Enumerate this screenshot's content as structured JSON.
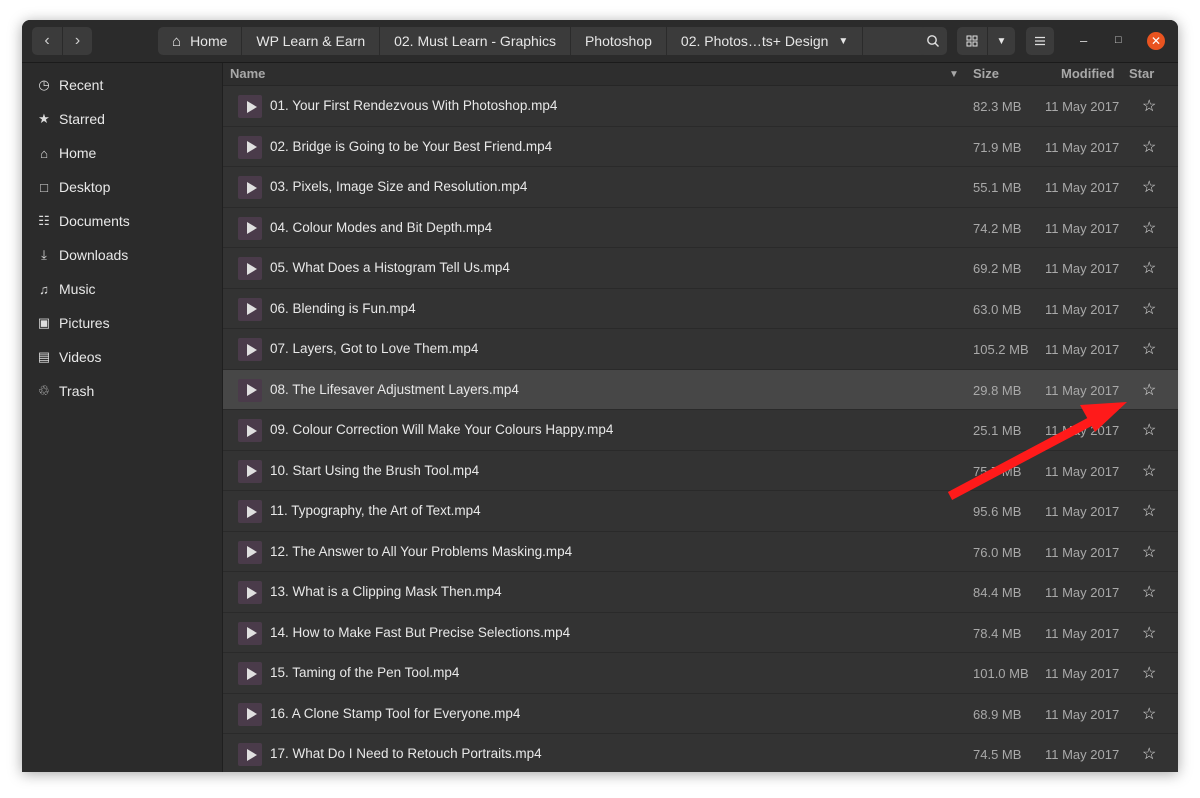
{
  "accent_color": "#e95420",
  "annotation_color": "#ff1a1a",
  "navigation": {
    "back_icon": "chevron-left-icon",
    "forward_icon": "chevron-right-icon"
  },
  "pathbar": {
    "home_icon": "home-icon",
    "crumbs": [
      "Home",
      "WP Learn & Earn",
      "02. Must Learn - Graphics",
      "Photoshop",
      "02. Photos…ts+ Design"
    ]
  },
  "sidebar": {
    "items": [
      {
        "label": "Recent",
        "icon": "clock-icon"
      },
      {
        "label": "Starred",
        "icon": "star-icon"
      },
      {
        "label": "Home",
        "icon": "home-icon"
      },
      {
        "label": "Desktop",
        "icon": "desktop-icon"
      },
      {
        "label": "Documents",
        "icon": "document-icon"
      },
      {
        "label": "Downloads",
        "icon": "download-icon"
      },
      {
        "label": "Music",
        "icon": "music-icon"
      },
      {
        "label": "Pictures",
        "icon": "picture-icon"
      },
      {
        "label": "Videos",
        "icon": "video-icon"
      },
      {
        "label": "Trash",
        "icon": "trash-icon"
      }
    ]
  },
  "columns": {
    "name": "Name",
    "size": "Size",
    "modified": "Modified",
    "star": "Star"
  },
  "files": [
    {
      "name": "01. Your First Rendezvous With Photoshop.mp4",
      "size": "82.3 MB",
      "modified": "11 May 2017"
    },
    {
      "name": "02. Bridge is Going to be Your Best Friend.mp4",
      "size": "71.9 MB",
      "modified": "11 May 2017"
    },
    {
      "name": "03. Pixels, Image Size and Resolution.mp4",
      "size": "55.1 MB",
      "modified": "11 May 2017"
    },
    {
      "name": "04. Colour Modes and Bit Depth.mp4",
      "size": "74.2 MB",
      "modified": "11 May 2017"
    },
    {
      "name": "05. What Does a Histogram Tell Us.mp4",
      "size": "69.2 MB",
      "modified": "11 May 2017"
    },
    {
      "name": "06. Blending is Fun.mp4",
      "size": "63.0 MB",
      "modified": "11 May 2017"
    },
    {
      "name": "07. Layers, Got to Love Them.mp4",
      "size": "105.2 MB",
      "modified": "11 May 2017"
    },
    {
      "name": "08. The Lifesaver Adjustment Layers.mp4",
      "size": "29.8 MB",
      "modified": "11 May 2017",
      "selected": true
    },
    {
      "name": "09. Colour Correction Will Make Your Colours Happy.mp4",
      "size": "25.1 MB",
      "modified": "11 May 2017"
    },
    {
      "name": "10. Start Using the Brush Tool.mp4",
      "size": "75.7 MB",
      "modified": "11 May 2017"
    },
    {
      "name": "11. Typography, the Art of Text.mp4",
      "size": "95.6 MB",
      "modified": "11 May 2017"
    },
    {
      "name": "12. The Answer to All Your Problems Masking.mp4",
      "size": "76.0 MB",
      "modified": "11 May 2017"
    },
    {
      "name": "13. What is a Clipping Mask Then.mp4",
      "size": "84.4 MB",
      "modified": "11 May 2017"
    },
    {
      "name": "14. How to Make Fast But Precise Selections.mp4",
      "size": "78.4 MB",
      "modified": "11 May 2017"
    },
    {
      "name": "15. Taming of the Pen Tool.mp4",
      "size": "101.0 MB",
      "modified": "11 May 2017"
    },
    {
      "name": "16. A Clone Stamp Tool for Everyone.mp4",
      "size": "68.9 MB",
      "modified": "11 May 2017"
    },
    {
      "name": "17. What Do I Need to Retouch Portraits.mp4",
      "size": "74.5 MB",
      "modified": "11 May 2017"
    }
  ]
}
